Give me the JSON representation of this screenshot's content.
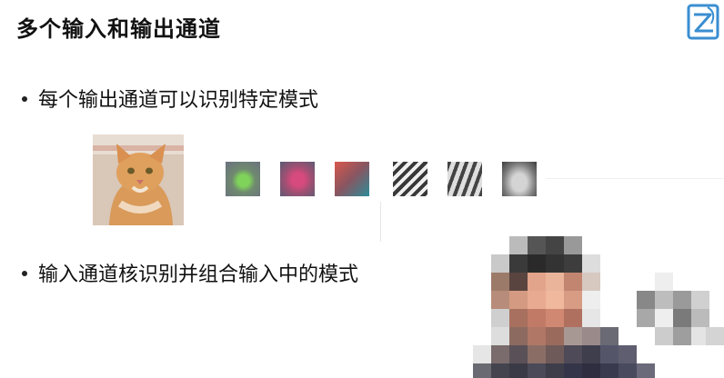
{
  "slide": {
    "title": "多个输入和输出通道",
    "bullets": [
      "每个输出通道可以识别特定模式",
      "输入通道核识别并组合输入中的模式"
    ]
  },
  "images": {
    "cat_photo": "cat-photo",
    "patterns": [
      "green-blob-pattern",
      "pink-blob-pattern",
      "red-teal-gradient-pattern",
      "diagonal-stripes-pattern",
      "vertical-stripes-pattern",
      "gray-blob-pattern"
    ],
    "presenter": "pixelated-presenter-video"
  },
  "colors": {
    "background": "#ffffff",
    "text": "#111111",
    "logo_blue": "#3a8ed1"
  }
}
